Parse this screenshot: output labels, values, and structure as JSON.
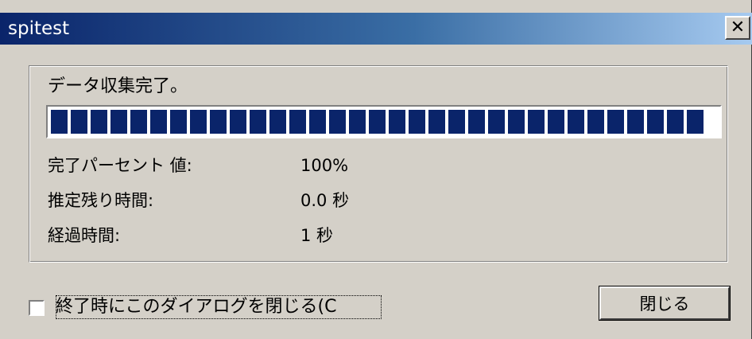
{
  "window": {
    "title": "spitest",
    "close_glyph": "✕",
    "close_icon": "close-icon"
  },
  "progress": {
    "status": "データ収集完了。",
    "value_percent": 100,
    "rows": [
      {
        "label": "完了パーセント 値:",
        "value": "100%"
      },
      {
        "label": "推定残り時間:",
        "value": "0.0 秒"
      },
      {
        "label": "経過時間:",
        "value": "1 秒"
      }
    ]
  },
  "footer": {
    "checkbox_label": "終了時にこのダイアログを閉じる(C",
    "checkbox_checked": false,
    "close_button_label": "閉じる"
  },
  "colors": {
    "progress_fill": "#0a246a",
    "title_start": "#0a246a",
    "title_end": "#a6caf0",
    "face": "#d4d0c8"
  }
}
